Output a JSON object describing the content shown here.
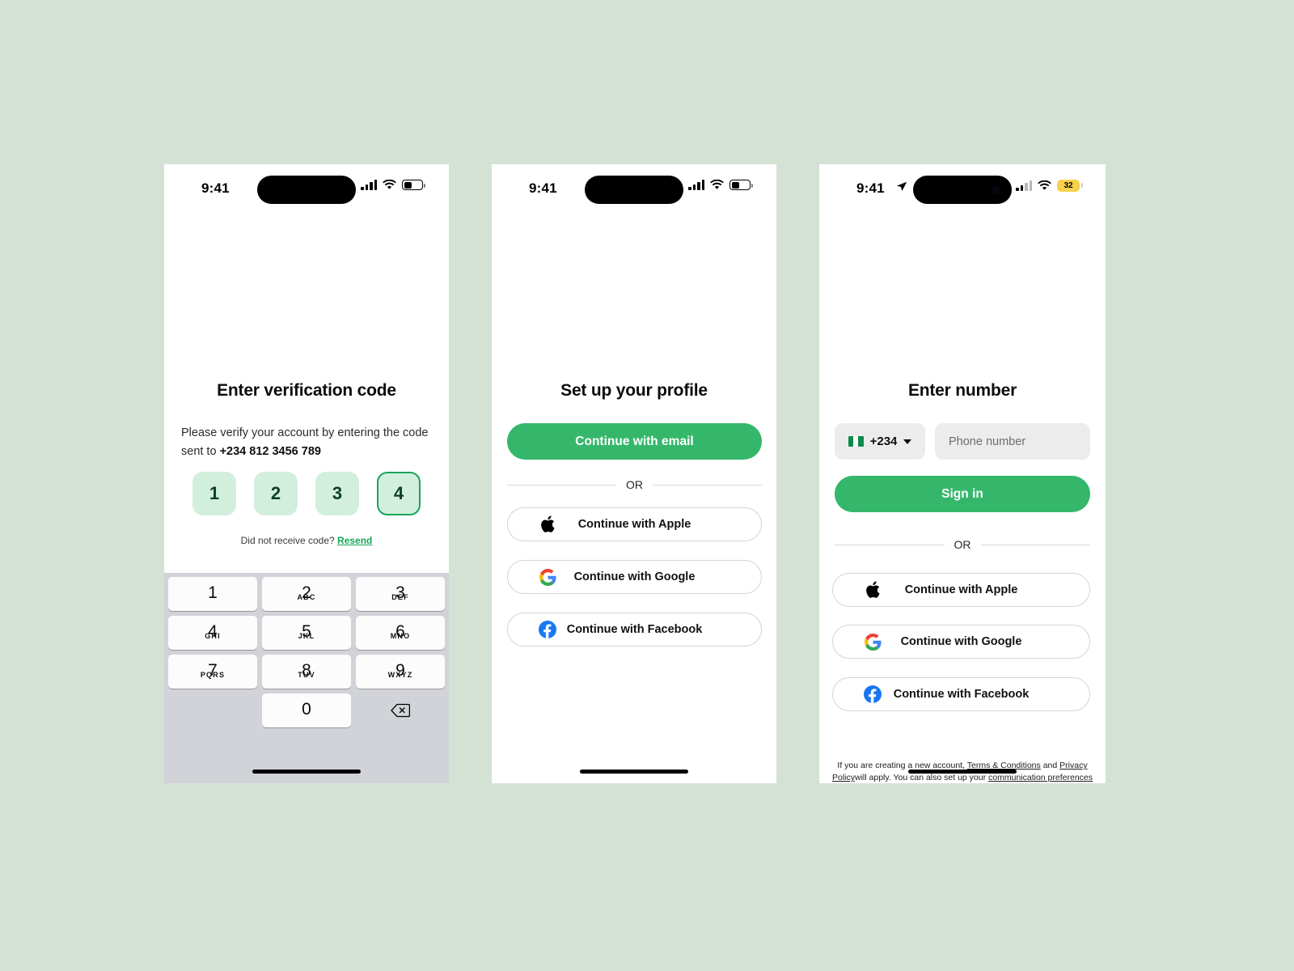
{
  "theme": {
    "canvas_bg": "#d3e2d5",
    "brand_green": "#35b76b",
    "code_box_bg": "#d2efdd",
    "code_box_active_border": "#18a558",
    "keyboard_bg": "#d1d3d8"
  },
  "screens": [
    {
      "id": "verification",
      "status_bar": {
        "time": "9:41",
        "battery_label": "",
        "wifi": "wifi-icon",
        "signal": "cellular-full"
      },
      "title": "Enter verification code",
      "subtitle_prefix": "Please verify your account by entering the code sent to ",
      "phone_number": "+234 812 3456 789",
      "code_digits": [
        "1",
        "2",
        "3",
        "4"
      ],
      "active_index": 3,
      "resend_prompt": "Did not receive code?",
      "resend_label": "Resend",
      "keypad": [
        {
          "digit": "1",
          "letters": ""
        },
        {
          "digit": "2",
          "letters": "ABC"
        },
        {
          "digit": "3",
          "letters": "DEF"
        },
        {
          "digit": "4",
          "letters": "GHI"
        },
        {
          "digit": "5",
          "letters": "JKL"
        },
        {
          "digit": "6",
          "letters": "MNO"
        },
        {
          "digit": "7",
          "letters": "PQRS"
        },
        {
          "digit": "8",
          "letters": "TUV"
        },
        {
          "digit": "9",
          "letters": "WXYZ"
        },
        {
          "digit": "0",
          "letters": ""
        }
      ],
      "delete_key": "backspace-icon"
    },
    {
      "id": "profile",
      "status_bar": {
        "time": "9:41"
      },
      "title": "Set up your profile",
      "primary_button": "Continue with email",
      "divider_label": "OR",
      "social_buttons": [
        {
          "icon": "apple-icon",
          "label": "Continue with Apple"
        },
        {
          "icon": "google-icon",
          "label": "Continue with Google"
        },
        {
          "icon": "facebook-icon",
          "label": "Continue with Facebook"
        }
      ]
    },
    {
      "id": "enter-number",
      "status_bar": {
        "time": "9:41",
        "location": "location-arrow-icon",
        "battery_percent": "32"
      },
      "title": "Enter number",
      "country_code": "+234",
      "country_flag": "nigeria-flag",
      "phone_placeholder": "Phone number",
      "primary_button": "Sign in",
      "divider_label": "OR",
      "social_buttons": [
        {
          "icon": "apple-icon",
          "label": "Continue with Apple"
        },
        {
          "icon": "google-icon",
          "label": "Continue with Google"
        },
        {
          "icon": "facebook-icon",
          "label": "Continue with Facebook"
        }
      ],
      "legal": {
        "line1_a": "If you are creating a new account, ",
        "terms": "Terms & Conditions",
        "line1_b": " and ",
        "privacy": "Privacy Policy",
        "line2_a": "will apply. You can also set up your ",
        "comm_prefs": "communication preferences"
      }
    }
  ]
}
